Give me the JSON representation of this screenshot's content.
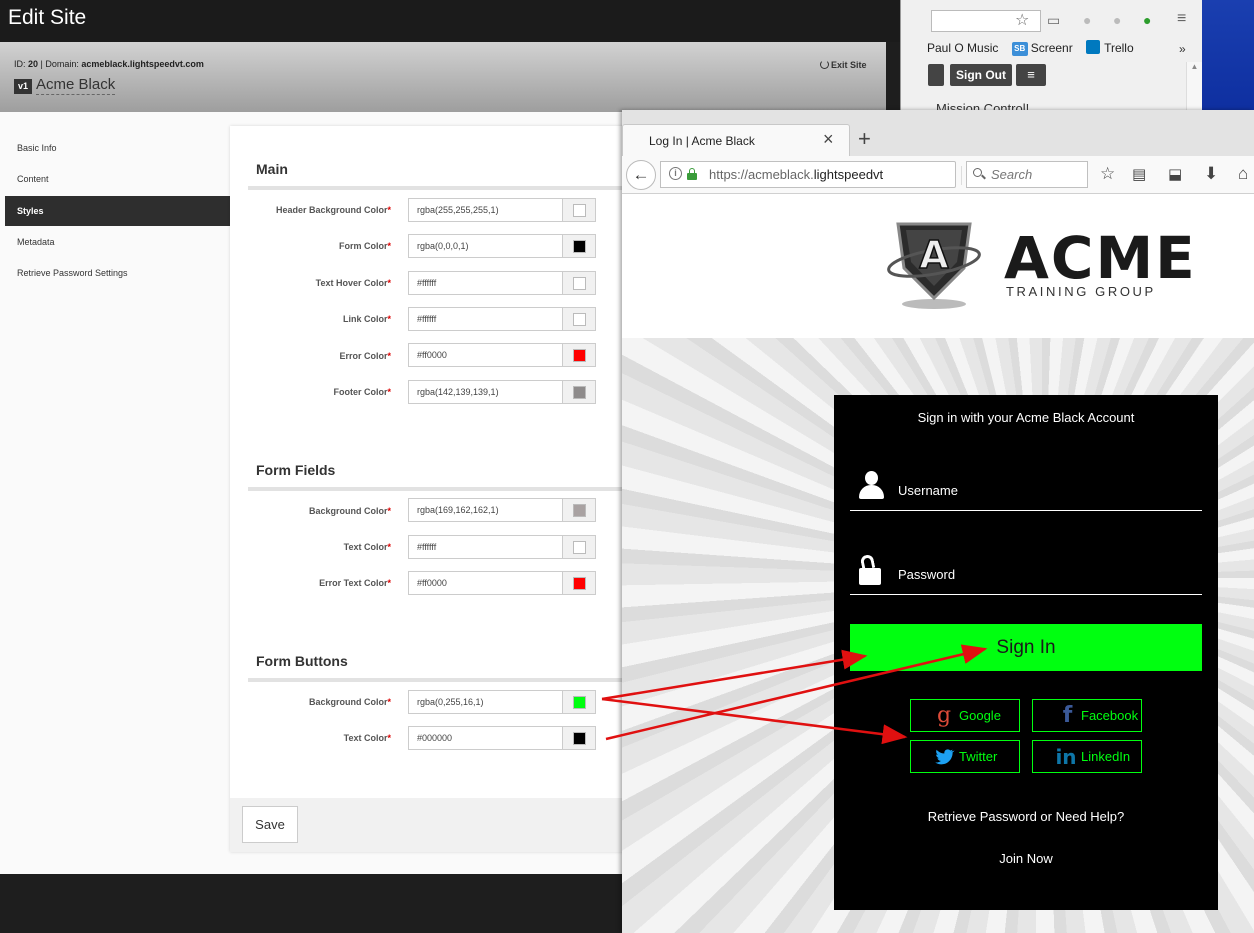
{
  "edit_site": {
    "title": "Edit Site",
    "meta_prefix_id": "ID: ",
    "site_id": "20",
    "meta_sep": " | Domain: ",
    "domain": "acmeblack.lightspeedvt.com",
    "version_badge": "v1",
    "site_name": "Acme Black",
    "exit_label": "Exit Site",
    "nav": [
      "Basic Info",
      "Content",
      "Styles",
      "Metadata",
      "Retrieve Password Settings"
    ],
    "nav_active_index": 2,
    "required_mark": "*",
    "sections": {
      "main": {
        "title": "Main",
        "fields": [
          {
            "label": "Header Background Color",
            "value": "rgba(255,255,255,1)",
            "swatch": "#ffffff"
          },
          {
            "label": "Form Color",
            "value": "rgba(0,0,0,1)",
            "swatch": "#000000"
          },
          {
            "label": "Text Hover Color",
            "value": "#ffffff",
            "swatch": "#ffffff"
          },
          {
            "label": "Link Color",
            "value": "#ffffff",
            "swatch": "#ffffff"
          },
          {
            "label": "Error Color",
            "value": "#ff0000",
            "swatch": "#ff0000"
          },
          {
            "label": "Footer Color",
            "value": "rgba(142,139,139,1)",
            "swatch": "#8e8b8b"
          }
        ]
      },
      "form_fields": {
        "title": "Form Fields",
        "fields": [
          {
            "label": "Background Color",
            "value": "rgba(169,162,162,1)",
            "swatch": "#a9a2a2"
          },
          {
            "label": "Text Color",
            "value": "#ffffff",
            "swatch": "#ffffff"
          },
          {
            "label": "Error Text Color",
            "value": "#ff0000",
            "swatch": "#ff0000"
          }
        ]
      },
      "form_buttons": {
        "title": "Form Buttons",
        "fields": [
          {
            "label": "Background Color",
            "value": "rgba(0,255,16,1)",
            "swatch": "#00ff10"
          },
          {
            "label": "Text Color",
            "value": "#000000",
            "swatch": "#000000"
          }
        ]
      }
    },
    "save_label": "Save"
  },
  "bg_browser": {
    "bookmarks": [
      "Paul O Music",
      "Screenr",
      "Trello"
    ],
    "sb_badge": "SB",
    "more": "»",
    "sign_out": "Sign Out",
    "page_text": "Mission Control!"
  },
  "browser": {
    "tab_title": "Log In | Acme Black",
    "tab_close": "×",
    "new_tab": "+",
    "url_prefix": "https://acmeblack.",
    "url_domain": "lightspeedvt",
    "search_placeholder": "Search"
  },
  "login_page": {
    "brand_word": "ACME",
    "brand_tagline": "TRAINING GROUP",
    "emblem_letter": "A",
    "heading": "Sign in with your Acme Black Account",
    "username_label": "Username",
    "password_label": "Password",
    "signin_label": "Sign In",
    "social": [
      "Google",
      "Facebook",
      "Twitter",
      "LinkedIn"
    ],
    "retrieve_link": "Retrieve Password or Need Help?",
    "join_link": "Join Now"
  },
  "colors": {
    "button_green": "#00ff10",
    "annotation_red": "#e01010"
  },
  "icons": [
    "power-icon",
    "star-icon",
    "cast-icon",
    "menu-icon",
    "back-arrow-icon",
    "info-icon",
    "lock-icon",
    "reload-icon",
    "search-icon",
    "bookmark-star-icon",
    "reading-list-icon",
    "pocket-icon",
    "download-icon",
    "home-icon",
    "user-icon",
    "unlock-icon",
    "google-icon",
    "facebook-icon",
    "twitter-icon",
    "linkedin-icon"
  ]
}
